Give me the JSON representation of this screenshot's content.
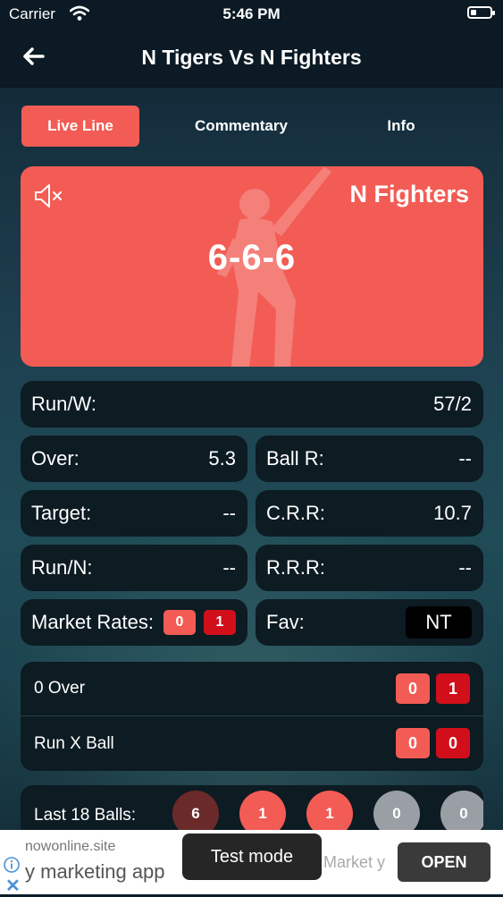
{
  "status_bar": {
    "carrier": "Carrier",
    "time": "5:46 PM"
  },
  "header": {
    "title": "N Tigers Vs N Fighters",
    "back_icon": "arrow-left-icon"
  },
  "tabs": [
    {
      "label": "Live Line",
      "active": true
    },
    {
      "label": "Commentary",
      "active": false
    },
    {
      "label": "Info",
      "active": false
    }
  ],
  "score_card": {
    "team": "N Fighters",
    "score": "6-6-6",
    "mute_icon": "speaker-mute-icon",
    "accent": "#f25c54"
  },
  "stats": {
    "run_w": {
      "label": "Run/W:",
      "value": "57/2"
    },
    "over": {
      "label": "Over:",
      "value": "5.3"
    },
    "ball_r": {
      "label": "Ball R:",
      "value": "--"
    },
    "target": {
      "label": "Target:",
      "value": "--"
    },
    "crr": {
      "label": "C.R.R:",
      "value": "10.7"
    },
    "run_n": {
      "label": "Run/N:",
      "value": "--"
    },
    "rrr": {
      "label": "R.R.R:",
      "value": "--"
    },
    "market_rates": {
      "label": "Market Rates:",
      "values": [
        "0",
        "1"
      ]
    },
    "fav": {
      "label": "Fav:",
      "value": "NT"
    }
  },
  "over_box": {
    "zero_over": {
      "label": "0 Over",
      "values": [
        "0",
        "1"
      ]
    },
    "run_x_ball": {
      "label": "Run X Ball",
      "values": [
        "0",
        "0"
      ]
    }
  },
  "last_balls": {
    "label": "Last 18 Balls:",
    "balls": [
      {
        "value": "6",
        "color": "#6b2a2a"
      },
      {
        "value": "1",
        "color": "#f25c54"
      },
      {
        "value": "1",
        "color": "#f25c54"
      },
      {
        "value": "0",
        "color": "#9a9fa5"
      },
      {
        "value": "0",
        "color": "#9a9fa5"
      }
    ]
  },
  "ad": {
    "site": "nowonline.site",
    "headline": "y marketing app",
    "headline2": "Market y",
    "open_label": "OPEN",
    "test_mode_label": "Test mode"
  }
}
